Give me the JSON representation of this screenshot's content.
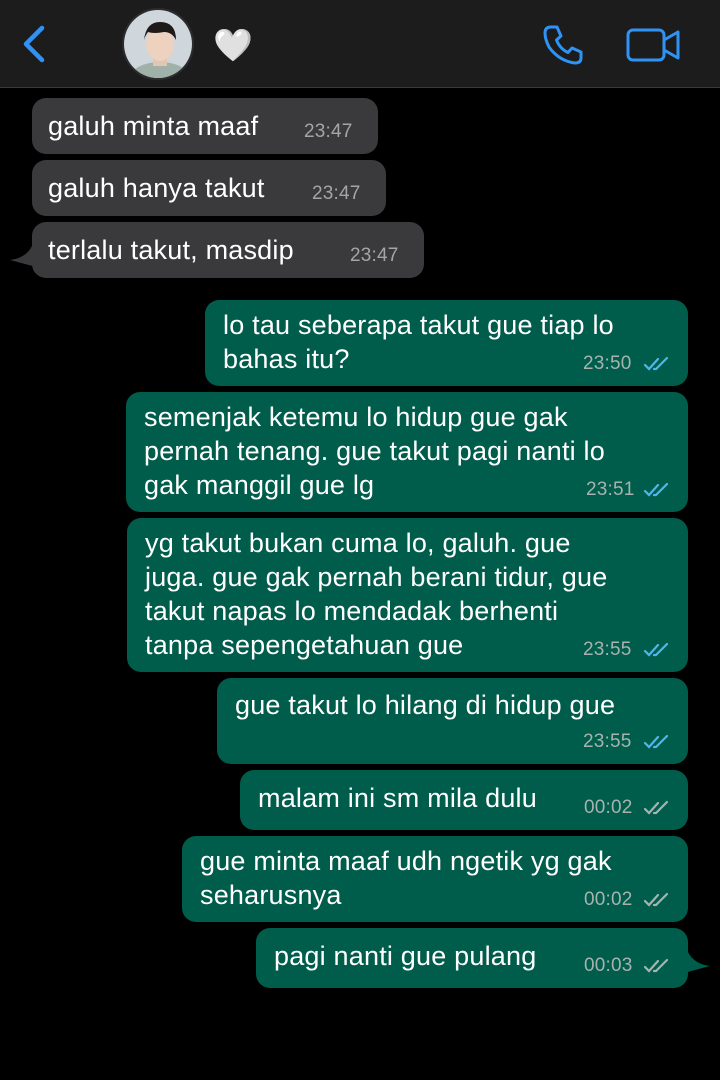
{
  "header": {
    "contact_name": "🤍",
    "colors": {
      "accent": "#2f93f5",
      "header_bg": "#1c1c1d"
    },
    "icons": [
      "back-chevron-icon",
      "phone-icon",
      "video-camera-icon"
    ]
  },
  "colors": {
    "incoming_bubble": "#3a3a3c",
    "outgoing_bubble": "#005c4b",
    "read_ticks": "#4fb6ec",
    "delivered_ticks": "#a7b3ae"
  },
  "messages": [
    {
      "direction": "incoming",
      "text": "galuh minta maaf",
      "time": "23:47"
    },
    {
      "direction": "incoming",
      "text": "galuh hanya takut",
      "time": "23:47"
    },
    {
      "direction": "incoming",
      "text": "terlalu takut, masdip",
      "time": "23:47"
    },
    {
      "direction": "outgoing",
      "text": "lo tau seberapa takut gue tiap lo\nbahas itu?",
      "time": "23:50",
      "status": "read"
    },
    {
      "direction": "outgoing",
      "text": "semenjak ketemu lo hidup gue gak\npernah tenang. gue takut pagi nanti lo\ngak manggil gue lg",
      "time": "23:51",
      "status": "read"
    },
    {
      "direction": "outgoing",
      "text": "yg takut bukan cuma lo, galuh. gue\njuga. gue gak pernah berani tidur, gue\ntakut napas lo mendadak berhenti\ntanpa sepengetahuan gue",
      "time": "23:55",
      "status": "read"
    },
    {
      "direction": "outgoing",
      "text": "gue takut lo hilang di hidup gue",
      "time": "23:55",
      "status": "read"
    },
    {
      "direction": "outgoing",
      "text": "malam ini sm mila dulu",
      "time": "00:02",
      "status": "delivered"
    },
    {
      "direction": "outgoing",
      "text": "gue minta maaf udh ngetik yg gak\nseharusnya",
      "time": "00:02",
      "status": "delivered"
    },
    {
      "direction": "outgoing",
      "text": "pagi nanti gue pulang",
      "time": "00:03",
      "status": "delivered"
    }
  ]
}
